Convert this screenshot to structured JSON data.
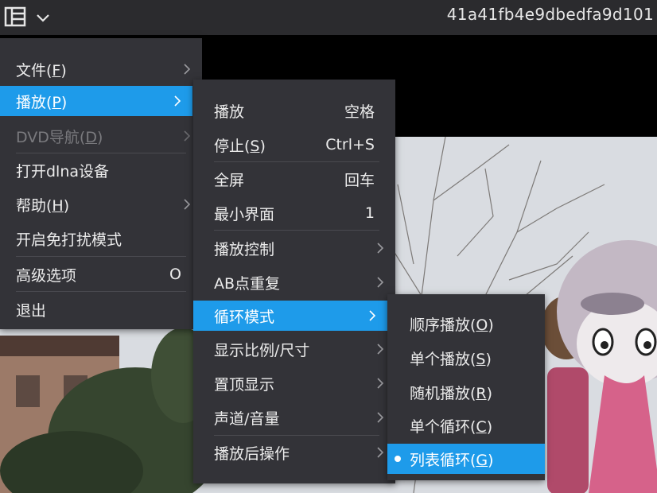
{
  "window": {
    "title": "41a41fb4e9dbedfa9d101",
    "icons": [
      "layout-grid-icon",
      "chevron-down-icon"
    ]
  },
  "main_menu": {
    "items": [
      {
        "label": "文件(",
        "mnemonic": "F",
        "close": ")",
        "has_submenu": true,
        "state": "normal"
      },
      {
        "label": "播放(",
        "mnemonic": "P",
        "close": ")",
        "has_submenu": true,
        "state": "active"
      },
      {
        "label": "DVD导航(",
        "mnemonic": "D",
        "close": ")",
        "has_submenu": true,
        "state": "disabled"
      },
      {
        "label": "打开dlna设备",
        "has_submenu": false,
        "state": "normal"
      },
      {
        "label": "帮助(",
        "mnemonic": "H",
        "close": ")",
        "has_submenu": true,
        "state": "normal"
      },
      {
        "label": "开启免打扰模式",
        "has_submenu": false,
        "state": "normal"
      },
      {
        "label": "高级选项",
        "shortcut": "O",
        "has_submenu": false,
        "state": "normal"
      },
      {
        "label": "退出",
        "has_submenu": false,
        "state": "normal"
      }
    ]
  },
  "play_menu": {
    "items": [
      {
        "label": "播放",
        "shortcut": "空格"
      },
      {
        "label": "停止(",
        "mnemonic": "S",
        "close": ")",
        "shortcut": "Ctrl+S"
      },
      {
        "label": "全屏",
        "shortcut": "回车"
      },
      {
        "label": "最小界面",
        "shortcut": "1"
      },
      {
        "label": "播放控制",
        "has_submenu": true
      },
      {
        "label": "AB点重复",
        "has_submenu": true
      },
      {
        "label": "循环模式",
        "has_submenu": true,
        "state": "active"
      },
      {
        "label": "显示比例/尺寸",
        "has_submenu": true
      },
      {
        "label": "置顶显示",
        "has_submenu": true
      },
      {
        "label": "声道/音量",
        "has_submenu": true
      },
      {
        "label": "播放后操作",
        "has_submenu": true
      }
    ]
  },
  "loop_menu": {
    "items": [
      {
        "label": "顺序播放(",
        "mnemonic": "O",
        "close": ")"
      },
      {
        "label": "单个播放(",
        "mnemonic": "S",
        "close": ")"
      },
      {
        "label": "随机播放(",
        "mnemonic": "R",
        "close": ")"
      },
      {
        "label": "单个循环(",
        "mnemonic": "C",
        "close": ")"
      },
      {
        "label": "列表循环(",
        "mnemonic": "G",
        "close": ")",
        "checked": true,
        "state": "active"
      }
    ]
  },
  "colors": {
    "menu_bg": "#333338",
    "highlight": "#1e9bea",
    "titlebar": "#2b2b2e"
  }
}
